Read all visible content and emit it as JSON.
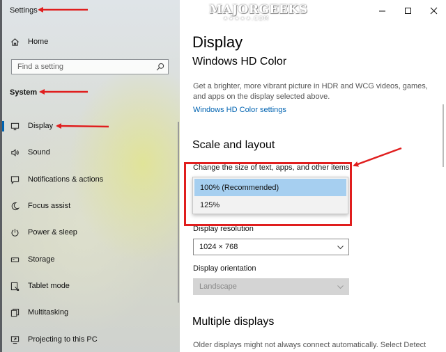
{
  "app": {
    "title": "Settings"
  },
  "logo": {
    "text": "MAJORGEEKS",
    "sub": "★★★★★.COM"
  },
  "sidebar": {
    "home_label": "Home",
    "search_placeholder": "Find a setting",
    "section_label": "System",
    "items": [
      {
        "label": "Display",
        "icon": "monitor-icon",
        "selected": true
      },
      {
        "label": "Sound",
        "icon": "speaker-icon"
      },
      {
        "label": "Notifications & actions",
        "icon": "notification-icon"
      },
      {
        "label": "Focus assist",
        "icon": "moon-icon"
      },
      {
        "label": "Power & sleep",
        "icon": "power-icon"
      },
      {
        "label": "Storage",
        "icon": "storage-icon"
      },
      {
        "label": "Tablet mode",
        "icon": "tablet-icon"
      },
      {
        "label": "Multitasking",
        "icon": "multitasking-icon"
      },
      {
        "label": "Projecting to this PC",
        "icon": "projecting-icon"
      }
    ]
  },
  "main": {
    "page_title": "Display",
    "hd_color": {
      "heading": "Windows HD Color",
      "description": "Get a brighter, more vibrant picture in HDR and WCG videos, games, and apps on the display selected above.",
      "link": "Windows HD Color settings"
    },
    "scale": {
      "heading": "Scale and layout",
      "size_label": "Change the size of text, apps, and other items",
      "options": [
        "100% (Recommended)",
        "125%"
      ],
      "selected_option": "100% (Recommended)",
      "resolution_label": "Display resolution",
      "resolution_value": "1024 × 768",
      "orientation_label": "Display orientation",
      "orientation_value": "Landscape"
    },
    "multiple": {
      "heading": "Multiple displays",
      "description": "Older displays might not always connect automatically. Select Detect"
    }
  },
  "colors": {
    "accent": "#0063b1",
    "annotation_red": "#e01e1e",
    "dropdown_highlight": "#a6cff0"
  }
}
